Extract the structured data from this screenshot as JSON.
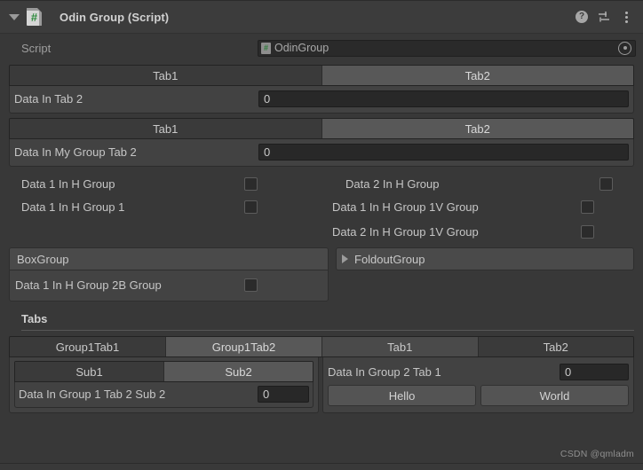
{
  "window": {
    "component_title": "Odin Group (Script)",
    "foldout_icon": "triangle-down-icon",
    "script_icon": "csharp-script-icon",
    "script_icon_glyph": "#",
    "help_icon": "help-icon",
    "help_glyph": "?",
    "preset_icon": "preset-settings-icon",
    "menu_icon": "kebab-menu-icon"
  },
  "script_row": {
    "label": "Script",
    "value": "OdinGroup",
    "icon_glyph": "#",
    "picker_icon": "object-picker-icon"
  },
  "tab_group_1": {
    "tabs": [
      {
        "label": "Tab1",
        "state": "unselected"
      },
      {
        "label": "Tab2",
        "state": "selected"
      }
    ],
    "field": {
      "label": "Data In Tab 2",
      "value": "0"
    }
  },
  "tab_group_2": {
    "tabs": [
      {
        "label": "Tab1",
        "state": "unselected"
      },
      {
        "label": "Tab2",
        "state": "selected"
      }
    ],
    "field": {
      "label": "Data In My Group Tab 2",
      "value": "0"
    }
  },
  "horizontal_groups": {
    "left": [
      {
        "label": "Data 1 In H Group",
        "checked": false
      },
      {
        "label": "Data 1 In H Group 1",
        "checked": false
      }
    ],
    "right": [
      {
        "label": "Data 2 In H Group",
        "checked": false
      },
      {
        "label": "Data 1 In H Group 1V Group",
        "checked": false
      },
      {
        "label": "Data 2 In H Group 1V Group",
        "checked": false
      }
    ]
  },
  "box_group": {
    "title": "BoxGroup",
    "toggle": {
      "label": "Data 1 In H Group 2B Group",
      "checked": false
    }
  },
  "foldout_group": {
    "title": "FoldoutGroup",
    "arrow_icon": "triangle-right-icon",
    "expanded": false
  },
  "tabs_section": {
    "title": "Tabs",
    "top_tabs": [
      {
        "label": "Group1Tab1",
        "state": "unselected"
      },
      {
        "label": "Group1Tab2",
        "state": "selected"
      },
      {
        "label": "Tab1",
        "state": "active"
      },
      {
        "label": "Tab2",
        "state": "unselected"
      }
    ],
    "left_panel": {
      "sub_tabs": [
        {
          "label": "Sub1",
          "state": "unselected"
        },
        {
          "label": "Sub2",
          "state": "selected"
        }
      ],
      "field": {
        "label": "Data In Group 1 Tab 2 Sub 2",
        "value": "0"
      }
    },
    "right_panel": {
      "field": {
        "label": "Data In Group 2 Tab 1",
        "value": "0"
      },
      "buttons": [
        {
          "label": "Hello"
        },
        {
          "label": "World"
        }
      ]
    }
  },
  "watermark": "CSDN @qmladm",
  "colors": {
    "background": "#383838",
    "panel": "#424242",
    "tab_selected": "#585858",
    "tab_active": "#4a4a4a",
    "tab_unselected": "#3a3a3a",
    "field_bg": "#282828",
    "text": "#c6c6c6",
    "accent_green": "#2c8a3c"
  }
}
